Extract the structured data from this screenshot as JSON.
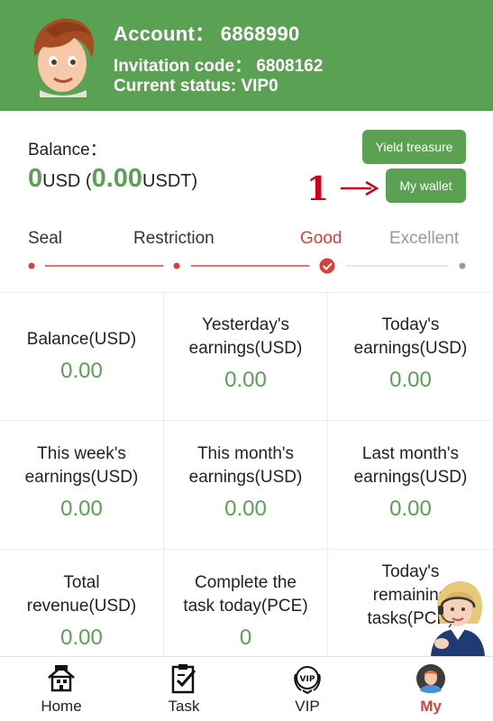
{
  "header": {
    "account_text": "Account： 6868990",
    "invitation_text": "Invitation code： 6808162",
    "status_text": "Current status: VIP0",
    "bg_color": "#5aa153"
  },
  "balance": {
    "label": "Balance：",
    "usd_value": "0",
    "usd_unit": "USD (",
    "usdt_value": "0.00",
    "usdt_unit": "USDT)"
  },
  "buttons": {
    "yield_label": "Yield treasure",
    "wallet_label": "My wallet"
  },
  "annotation": {
    "number": "1"
  },
  "levels": {
    "items": [
      "Seal",
      "Restriction",
      "Good",
      "Excellent"
    ],
    "current": "Good"
  },
  "stats": [
    {
      "label": "Balance(USD)",
      "value": "0.00"
    },
    {
      "label": "Yesterday's earnings(USD)",
      "value": "0.00"
    },
    {
      "label": "Today's earnings(USD)",
      "value": "0.00"
    },
    {
      "label": "This week's earnings(USD)",
      "value": "0.00"
    },
    {
      "label": "This month's earnings(USD)",
      "value": "0.00"
    },
    {
      "label": "Last month's earnings(USD)",
      "value": "0.00"
    },
    {
      "label": "Total revenue(USD)",
      "value": "0.00"
    },
    {
      "label": "Complete the task today(PCE)",
      "value": "0"
    },
    {
      "label": "Today's remaining tasks(PCE)",
      "value": ""
    }
  ],
  "nav": {
    "items": [
      {
        "label": "Home",
        "icon": "house-icon"
      },
      {
        "label": "Task",
        "icon": "clipboard-check-icon"
      },
      {
        "label": "VIP",
        "icon": "vip-badge-icon"
      },
      {
        "label": "My",
        "icon": "user-avatar-icon"
      }
    ],
    "active": "My",
    "active_color": "#d9403a"
  },
  "colors": {
    "accent": "#5aa153",
    "danger": "#d9403a",
    "muted": "#999999"
  }
}
